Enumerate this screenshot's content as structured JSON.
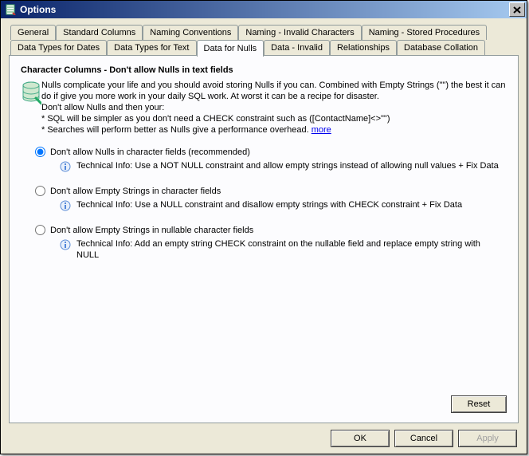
{
  "window": {
    "title": "Options"
  },
  "tabs": {
    "row1": [
      "General",
      "Standard Columns",
      "Naming Conventions",
      "Naming - Invalid Characters",
      "Naming - Stored Procedures"
    ],
    "row2": [
      "Data Types for Dates",
      "Data Types for Text",
      "Data for Nulls",
      "Data - Invalid",
      "Relationships",
      "Database Collation"
    ],
    "selected": "Data for Nulls"
  },
  "pane": {
    "heading": "Character Columns - Don't allow Nulls in text fields",
    "intro_line1": "Nulls complicate your life and you should avoid storing Nulls if you can. Combined with Empty Strings  (\"\") the best it can do if give you more work in your daily SQL work. At worst it can be a recipe for disaster.",
    "intro_line2": "Don't allow Nulls and then your:",
    "intro_b1": "* SQL will be simpler as you don't need a CHECK constraint such as ([ContactName]<>\"\")",
    "intro_b2_pre": "* Searches will perform better as Nulls give a performance overhead. ",
    "intro_link": "more",
    "options": [
      {
        "label": "Don't allow Nulls in character fields (recommended)",
        "tech": "Technical Info: Use a NOT NULL constraint and allow empty strings instead of allowing null values + Fix Data",
        "checked": true
      },
      {
        "label": "Don't allow Empty Strings in character fields",
        "tech": "Technical Info: Use a NULL constraint and disallow empty strings with CHECK constraint + Fix Data",
        "checked": false
      },
      {
        "label": "Don't allow Empty Strings in nullable character fields",
        "tech": "Technical Info: Add an empty string CHECK constraint on the nullable field and replace empty string with NULL",
        "checked": false
      }
    ],
    "reset": "Reset"
  },
  "buttons": {
    "ok": "OK",
    "cancel": "Cancel",
    "apply": "Apply"
  }
}
